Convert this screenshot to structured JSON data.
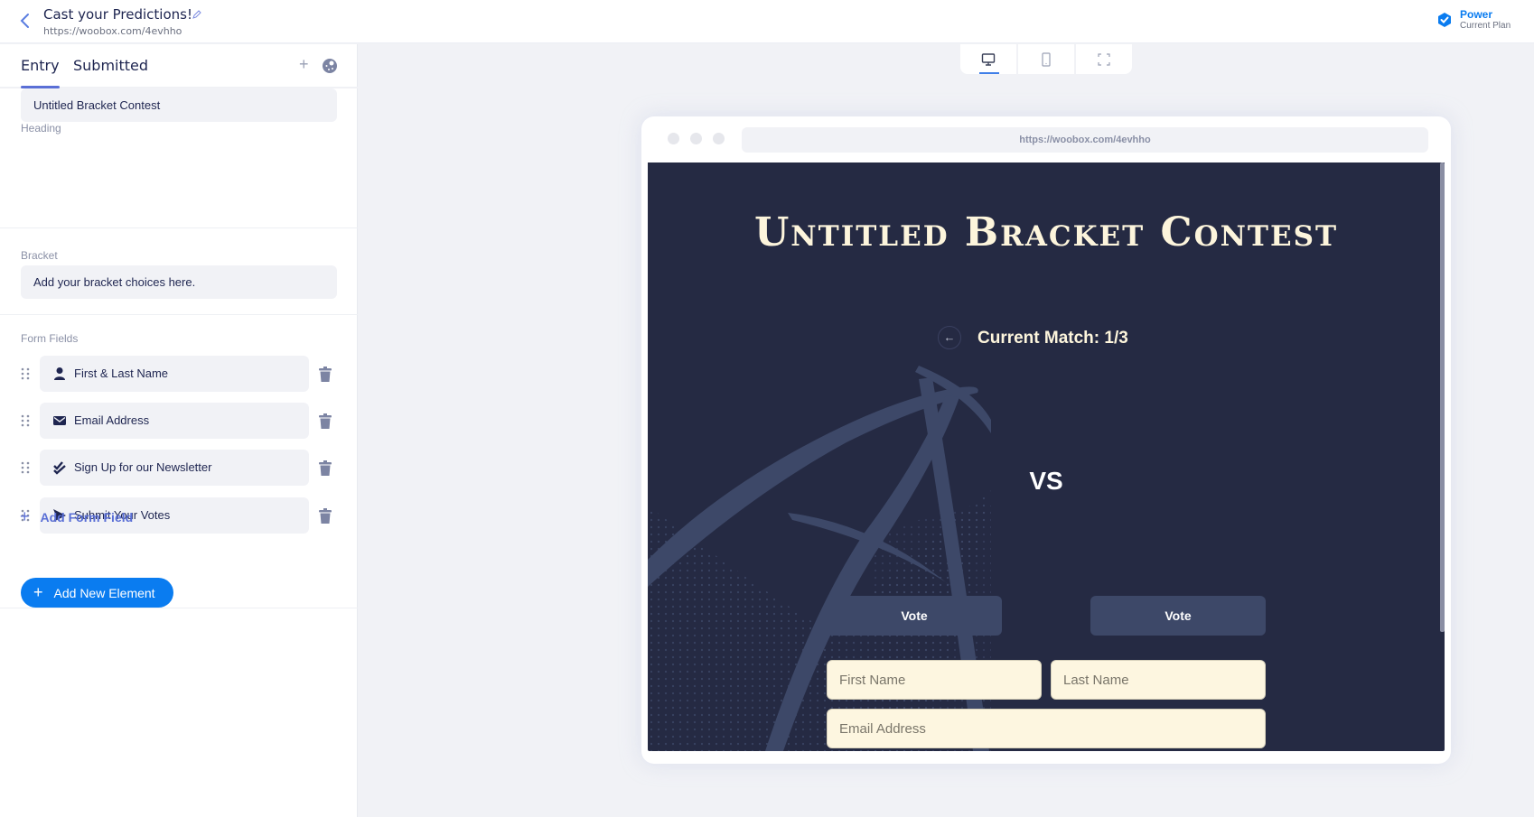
{
  "header": {
    "title": "Cast your Predictions!",
    "url": "https://woobox.com/4evhho",
    "plan": {
      "name": "Power",
      "label": "Current Plan"
    }
  },
  "sidebar": {
    "tabs": [
      {
        "label": "Entry",
        "active": true
      },
      {
        "label": "Submitted",
        "active": false
      }
    ],
    "heading": {
      "label": "Heading",
      "value": "Untitled Bracket Contest"
    },
    "bracket": {
      "label": "Bracket",
      "value": "Add your bracket choices here."
    },
    "form_fields": {
      "label": "Form Fields",
      "items": [
        {
          "icon": "user-icon",
          "label": "First & Last Name"
        },
        {
          "icon": "envelope-icon",
          "label": "Email Address"
        },
        {
          "icon": "double-check-icon",
          "label": "Sign Up for our Newsletter"
        },
        {
          "icon": "send-icon",
          "label": "Submit Your Votes"
        }
      ],
      "add_label": "Add Form Field"
    },
    "add_element_label": "Add New Element"
  },
  "device_toggle": {
    "options": [
      "desktop",
      "mobile",
      "fullscreen"
    ],
    "active": "desktop"
  },
  "preview": {
    "url": "https://woobox.com/4evhho",
    "title": "Untitled Bracket Contest",
    "match_label": "Current Match: 1/3",
    "vs_label": "VS",
    "vote_labels": [
      "Vote",
      "Vote"
    ],
    "inputs": {
      "first_name_placeholder": "First Name",
      "last_name_placeholder": "Last Name",
      "email_placeholder": "Email Address"
    }
  },
  "colors": {
    "accent": "#0a7cf0",
    "link": "#5a6fd6",
    "stage_bg": "#252a43",
    "title_cream": "#fdf5dc",
    "vote_btn": "#3d4868"
  }
}
